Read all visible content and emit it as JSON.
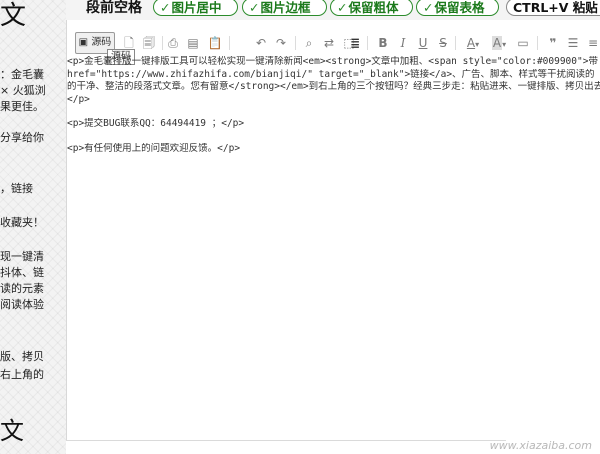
{
  "left_strip": {
    "top_char": "文",
    "fragments": [
      "：金毛囊",
      "× 火狐浏",
      "果更佳。",
      "分享给你",
      "，链接",
      "收藏夹！",
      "现一键清",
      "抖体、链",
      "读的元素",
      "阅读体验",
      "版、拷贝",
      "右上角的"
    ],
    "bottom_char": "文"
  },
  "header": {
    "title": "段前空格",
    "pills": [
      {
        "label": "图片居中",
        "check": "✓"
      },
      {
        "label": "图片边框",
        "check": "✓"
      },
      {
        "label": "保留粗体",
        "check": "✓"
      },
      {
        "label": "保留表格",
        "check": "✓"
      }
    ],
    "paste_label": "CTRL+V 粘贴"
  },
  "toolbar": {
    "source_label": "源码",
    "tooltip": "源码",
    "text_color_label": "A",
    "background_color_label": "A"
  },
  "code": {
    "p1_lines": [
      "<p>金毛囊排版一键排版工具可以轻松实现一键清除新闻<em><strong>文章中加粗、<span style=\"color:#009900\">带",
      "href=\"https://www.zhifazhifa.com/bianjiqi/\" target=\"_blank\">链接</a>、广告、脚本、样式等干扰阅读的",
      "的干净、整洁的段落式文章。您有留意</strong></em>到右上角的三个按钮吗？经典三步走：粘贴进来、一键排版、拷贝出去",
      "</p>"
    ],
    "p2": "<p>提交BUG联系QQ：64494419 ；</p>",
    "p3": "<p>有任何使用上的问题欢迎反馈。</p>"
  },
  "watermark": "www.xiazaiba.com"
}
